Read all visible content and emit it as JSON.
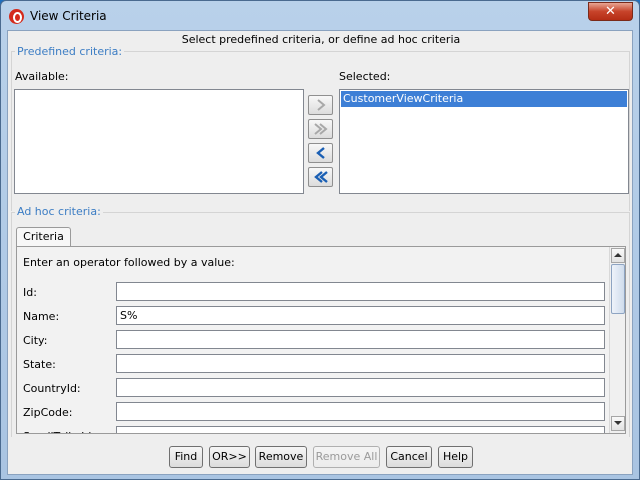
{
  "window": {
    "title": "View Criteria",
    "close_glyph": "✕"
  },
  "header_message": "Select predefined criteria, or define ad hoc criteria",
  "predefined": {
    "group_label": "Predefined criteria:",
    "available_label": "Available:",
    "selected_label": "Selected:",
    "available_items": [],
    "selected_items": [
      "CustomerViewCriteria"
    ],
    "shuttle_buttons": [
      {
        "name": "move-right-icon",
        "enabled": false
      },
      {
        "name": "move-all-right-icon",
        "enabled": false
      },
      {
        "name": "move-left-icon",
        "enabled": true
      },
      {
        "name": "move-all-left-icon",
        "enabled": true
      }
    ]
  },
  "adhoc": {
    "group_label": "Ad hoc criteria:",
    "tab_label": "Criteria",
    "hint": "Enter an operator followed by a value:",
    "fields": [
      {
        "label": "Id:",
        "value": ""
      },
      {
        "label": "Name:",
        "value": "S%"
      },
      {
        "label": "City:",
        "value": ""
      },
      {
        "label": "State:",
        "value": ""
      },
      {
        "label": "CountryId:",
        "value": ""
      },
      {
        "label": "ZipCode:",
        "value": ""
      },
      {
        "label": "SmallTaikaId:",
        "value": ""
      }
    ]
  },
  "buttons": {
    "find": "Find",
    "or": "OR>>",
    "remove": "Remove",
    "remove_all": "Remove All",
    "cancel": "Cancel",
    "help": "Help"
  },
  "colors": {
    "selection": "#3d7fd6",
    "group_label": "#3c7dc4",
    "close": "#c7432a"
  }
}
